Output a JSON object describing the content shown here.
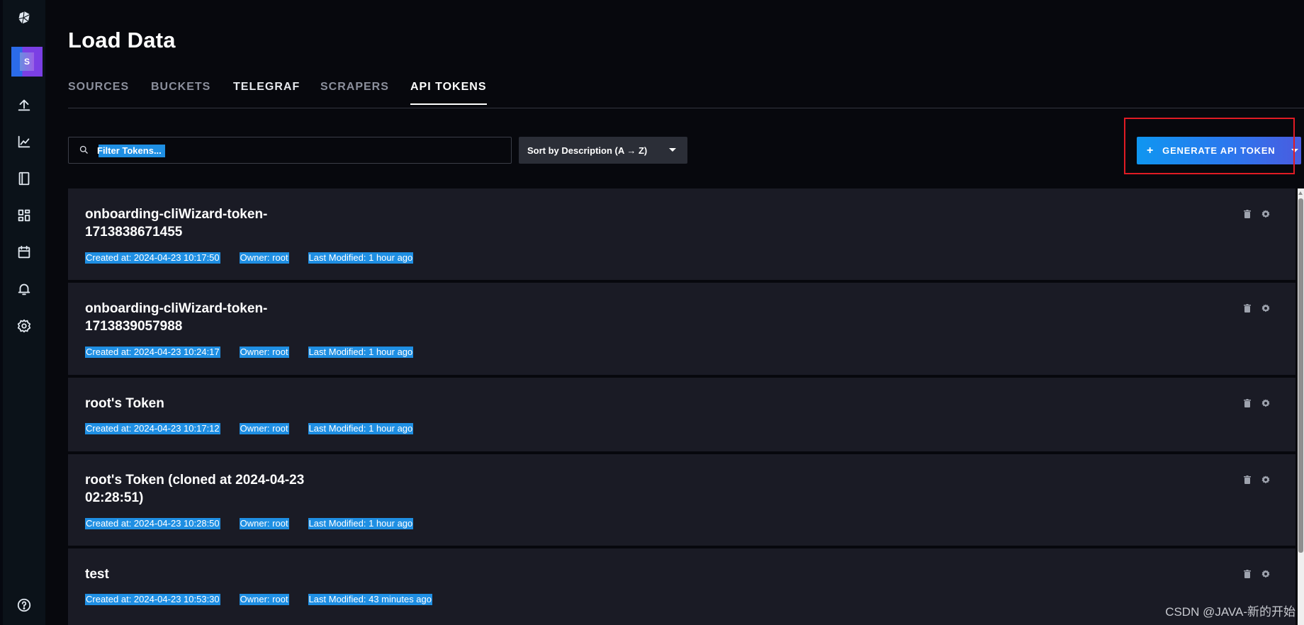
{
  "header": {
    "title": "Load Data"
  },
  "tabs": [
    {
      "label": "SOURCES"
    },
    {
      "label": "BUCKETS"
    },
    {
      "label": "TELEGRAF"
    },
    {
      "label": "SCRAPERS"
    },
    {
      "label": "API TOKENS"
    }
  ],
  "active_tab": "API TOKENS",
  "user": {
    "avatar_letter": "S"
  },
  "toolbar": {
    "search_placeholder": "Filter Tokens...",
    "sort_label": "Sort by Description (A → Z)",
    "generate_label": "GENERATE API TOKEN",
    "generate_icon": "plus-icon"
  },
  "tokens": [
    {
      "name": "onboarding-cliWizard-token-1713838671455",
      "created": "Created at: 2024-04-23 10:17:50",
      "owner": "Owner: root",
      "modified": "Last Modified: 1 hour ago"
    },
    {
      "name": "onboarding-cliWizard-token-1713839057988",
      "created": "Created at: 2024-04-23 10:24:17",
      "owner": "Owner: root",
      "modified": "Last Modified: 1 hour ago"
    },
    {
      "name": "root's Token",
      "created": "Created at: 2024-04-23 10:17:12",
      "owner": "Owner: root",
      "modified": "Last Modified: 1 hour ago"
    },
    {
      "name": "root's Token (cloned at 2024-04-23 02:28:51)",
      "created": "Created at: 2024-04-23 10:28:50",
      "owner": "Owner: root",
      "modified": "Last Modified: 1 hour ago"
    },
    {
      "name": "test",
      "created": "Created at: 2024-04-23 10:53:30",
      "owner": "Owner: root",
      "modified": "Last Modified: 43 minutes ago"
    }
  ],
  "sidebar": {
    "items": [
      {
        "icon": "logo-icon"
      },
      {
        "icon": "upload-icon"
      },
      {
        "icon": "chart-icon"
      },
      {
        "icon": "notebook-icon"
      },
      {
        "icon": "dashboard-icon"
      },
      {
        "icon": "calendar-icon"
      },
      {
        "icon": "bell-icon"
      },
      {
        "icon": "gear-icon"
      },
      {
        "icon": "help-icon"
      }
    ]
  },
  "colors": {
    "accent": "#1f8fe3",
    "highlight_box": "#e01b24",
    "card_bg": "#1a1b25",
    "page_bg": "#07080d"
  },
  "watermark": "CSDN @JAVA-新的开始"
}
